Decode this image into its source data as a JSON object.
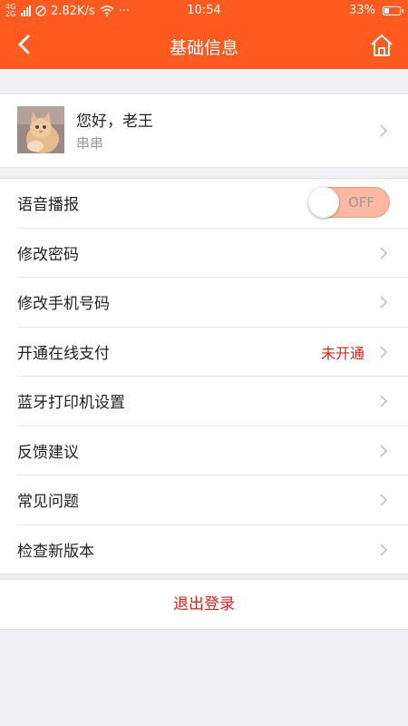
{
  "status_bar": {
    "network_type": "4G 2G",
    "speed": "2.82K/s",
    "dots": "···",
    "time": "10:54",
    "battery": "33%",
    "battery_level": 0.33
  },
  "nav": {
    "title": "基础信息",
    "back_icon": "chevron-left-icon",
    "home_icon": "home-icon"
  },
  "profile": {
    "greeting": "您好，老王",
    "name": "串串",
    "avatar_icon": "cat-avatar"
  },
  "settings": {
    "voice": {
      "label": "语音播报",
      "toggle_text": "OFF",
      "enabled": false
    },
    "change_password": {
      "label": "修改密码"
    },
    "change_phone": {
      "label": "修改手机号码"
    },
    "online_payment": {
      "label": "开通在线支付",
      "status": "未开通"
    },
    "bluetooth_printer": {
      "label": "蓝牙打印机设置"
    },
    "feedback": {
      "label": "反馈建议"
    },
    "faq": {
      "label": "常见问题"
    },
    "check_update": {
      "label": "检查新版本"
    }
  },
  "logout": {
    "label": "退出登录"
  },
  "colors": {
    "brand": "#ff5a1f",
    "toggle_bg": "#ffb9a0",
    "alert_red": "#e02020",
    "background": "#efeff4"
  }
}
